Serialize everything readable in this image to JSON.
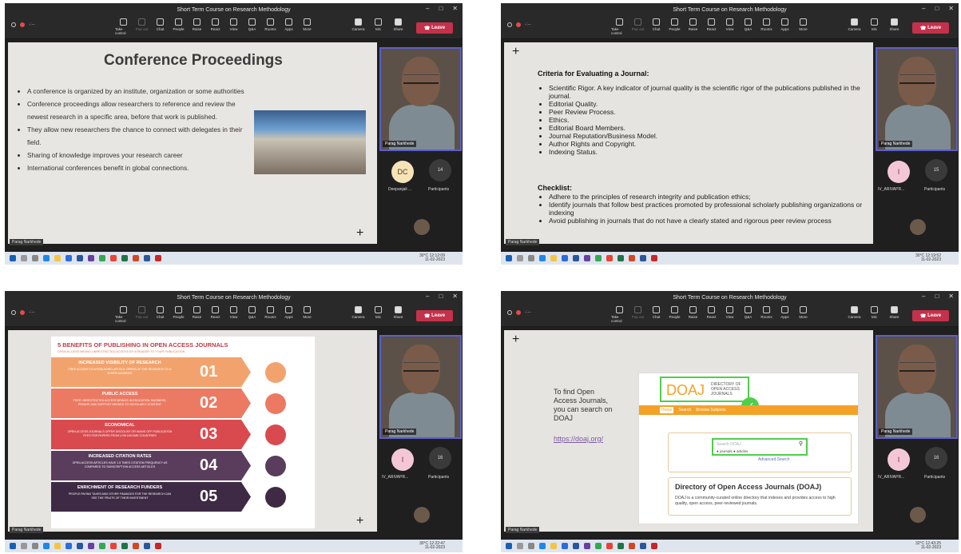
{
  "window_title": "Short Term Course on Research Methodology",
  "toolbar": {
    "buttons": [
      "Take control",
      "Pop out",
      "Chat",
      "People",
      "Raise",
      "React",
      "View",
      "Q&A",
      "Rooms",
      "Apps",
      "More"
    ],
    "media": [
      "Camera",
      "Mic",
      "Share"
    ],
    "leave": "Leave"
  },
  "presenter": "Parag Narkhede",
  "participants_label": "Participants",
  "panel1": {
    "slide_title": "Conference Proceedings",
    "bullets": [
      "A conference is organized by an institute, organization or some authorities",
      "Conference proceedings allow researchers to reference and review the newest research in a specific area, before that work is published.",
      "They allow new researchers the chance to connect with delegates in their field.",
      "Sharing of knowledge improves your research career",
      "International conferences benefit in global connections."
    ],
    "avatar_initials": "DC",
    "avatar_name": "Deepanjali ...",
    "participant_count": "14",
    "time": "12:12:09",
    "date": "11-02-2023",
    "temp": "30°C"
  },
  "panel2": {
    "criteria_heading": "Criteria for Evaluating a Journal:",
    "criteria": [
      "Scientific Rigor. A key indicator of journal quality is the scientific rigor of the publications published in the journal.",
      "Editorial Quality.",
      "Peer Review Process.",
      "Ethics.",
      "Editorial Board Members.",
      "Journal Reputation/Business Model.",
      "Author Rights and Copyright.",
      "Indexing Status."
    ],
    "checklist_heading": "Checklist:",
    "checklist": [
      "Adhere to the principles of research integrity and publication ethics;",
      "Identify journals that follow best practices promoted by professional scholarly publishing organizations or indexing",
      "Avoid publishing in journals that do not have a clearly stated and rigorous peer review process"
    ],
    "avatar_initials": "I",
    "avatar_name": "IV_ARIVAPR...",
    "participant_count": "15",
    "time": "12:19:52",
    "date": "11-02-2023",
    "temp": "30°C"
  },
  "panel3": {
    "title": "5 BENEFITS OF PUBLISHING IN OPEN ACCESS JOURNALS",
    "subtitle": "OPEN ACCESS MEANS UNRESTRICTED ACCESS BY A READER TO YOUR PUBLICATION",
    "benefits": [
      {
        "num": "01",
        "heading": "INCREASED VISIBILITY OF RESEARCH",
        "text": "FREE ACCESS TO A PUBLISHED ARTICLE OPENS UP THE RESEARCH TO A WIDER AUDIENCE",
        "color": "#f2a36d"
      },
      {
        "num": "02",
        "heading": "PUBLIC ACCESS",
        "text": "FREE UNRESTRICTED ACCESS BRINGS IN EDUCATION, BUSINESS, PRIVATE AND SUPPORT NEEDED TO SCHOLARLY CONTENT",
        "color": "#ec7a62"
      },
      {
        "num": "03",
        "heading": "ECONOMICAL",
        "text": "OPEN ACCESS JOURNALS OFFER DISCOUNT OR WAIVE OFF PUBLICATION FEES FOR PAPERS FROM LOW INCOME COUNTRIES",
        "color": "#d94a4f"
      },
      {
        "num": "04",
        "heading": "INCREASED CITATION RATES",
        "text": "OPEN ACCESS ARTICLES HAVE 1.5 TIMES CITATION FREQUENCY AS COMPARED TO SUBSCRIPTION ACCESS ARTICLES",
        "color": "#5a3d5c"
      },
      {
        "num": "05",
        "heading": "ENRICHMENT OF RESEARCH FUNDERS",
        "text": "PEOPLE PAYING TAXES AND OTHER FINANCES FOR THE RESEARCH CAN SEE THE FRUITS OF THEIR INVESTMENT",
        "color": "#3e2a44"
      }
    ],
    "avatar_initials": "I",
    "avatar_name": "IV_ARIVAPR...",
    "participant_count": "16",
    "time": "12:22:47",
    "date": "11-02-2023",
    "temp": "30°C"
  },
  "panel4": {
    "lines": [
      "To find Open",
      "Access Journals,",
      "you can search on",
      "DOAJ"
    ],
    "link": "https://doaj.org/",
    "doaj_logo": "DOAJ",
    "doaj_logo_sub": "DIRECTORY OF OPEN ACCESS JOURNALS",
    "nav": [
      "Home",
      "Search",
      "Browse Subjects"
    ],
    "search_placeholder": "Search DOAJ",
    "options": [
      "journals",
      "articles"
    ],
    "advanced": "Advanced Search",
    "doaj_title": "Directory of Open Access Journals (DOAJ)",
    "doaj_desc": "DOAJ is a community-curated online directory that indexes and provides access to high quality, open access, peer-reviewed journals.",
    "avatar_initials": "I",
    "avatar_name": "IV_ARIVAPR...",
    "participant_count": "16",
    "time": "12:43:25",
    "date": "11-02-2023",
    "temp": "32°C"
  }
}
